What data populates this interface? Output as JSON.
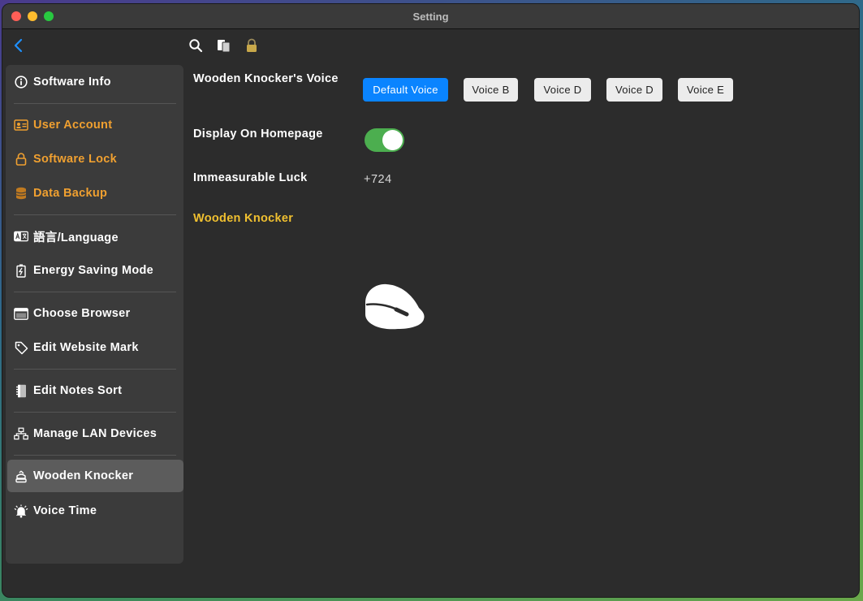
{
  "window": {
    "title": "Setting"
  },
  "sidebar": {
    "items": [
      {
        "label": "Software Info",
        "icon": "info-icon"
      },
      {
        "label": "User Account",
        "icon": "id-card-icon"
      },
      {
        "label": "Software Lock",
        "icon": "lock-icon"
      },
      {
        "label": "Data Backup",
        "icon": "database-icon"
      },
      {
        "label": "語言/Language",
        "icon": "language-icon"
      },
      {
        "label": "Energy Saving Mode",
        "icon": "battery-icon"
      },
      {
        "label": "Choose Browser",
        "icon": "browser-icon"
      },
      {
        "label": "Edit Website Mark",
        "icon": "tag-icon"
      },
      {
        "label": "Edit Notes Sort",
        "icon": "notebook-icon"
      },
      {
        "label": "Manage LAN Devices",
        "icon": "network-icon"
      },
      {
        "label": "Wooden Knocker",
        "icon": "wooden-fish-icon"
      },
      {
        "label": "Voice Time",
        "icon": "bell-icon"
      }
    ],
    "selected": "Wooden Knocker"
  },
  "main": {
    "voice_label": "Wooden Knocker's Voice",
    "voices": [
      "Default Voice",
      "Voice B",
      "Voice D",
      "Voice D",
      "Voice E"
    ],
    "selected_voice": "Default Voice",
    "homepage_label": "Display On Homepage",
    "homepage_on": true,
    "luck_label": "Immeasurable Luck",
    "luck_value": "+724",
    "knocker_label": "Wooden Knocker"
  },
  "colors": {
    "accent": "#0a84ff",
    "toggle_on": "#4cae4f",
    "orange": "#f0a030",
    "yellow": "#f0c030"
  }
}
